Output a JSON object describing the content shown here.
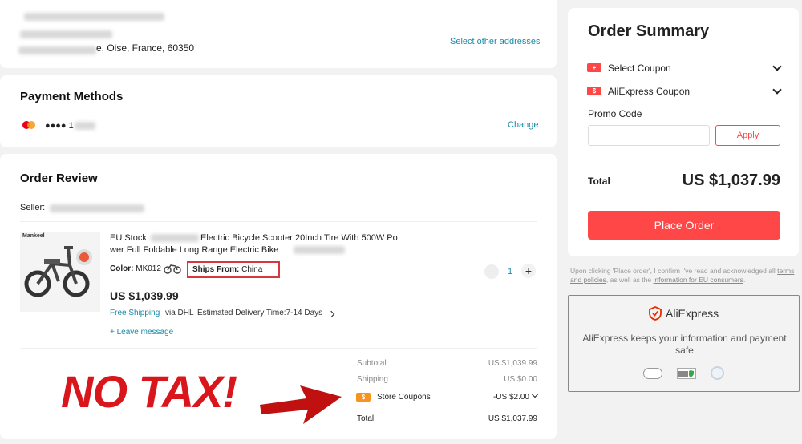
{
  "address": {
    "line3_suffix": "e, Oise, France, 60350",
    "select_other_label": "Select other addresses"
  },
  "payment": {
    "title": "Payment Methods",
    "card_dots": "●●●● 1",
    "change_label": "Change"
  },
  "review": {
    "title": "Order Review",
    "seller_label": "Seller:",
    "product_brand": "Mankeel",
    "product_title_part1": "EU Stock",
    "product_title_part2": "Electric Bicycle Scooter 20Inch Tire With 500W Po",
    "product_title_line2": "wer Full Foldable Long Range Electric Bike",
    "color_label": "Color:",
    "color_value": "MK012",
    "ships_from_label": "Ships From:",
    "ships_from_value": "China",
    "quantity": "1",
    "price": "US $1,039.99",
    "free_shipping": "Free Shipping",
    "shipping_via": "via DHL",
    "delivery_label": "Estimated Delivery Time:7-14 Days",
    "leave_message": "+ Leave message",
    "subtotal_label": "Subtotal",
    "subtotal_value": "US $1,039.99",
    "shipping_label": "Shipping",
    "shipping_value": "US $0.00",
    "store_coupons_label": "Store Coupons",
    "store_coupons_value": "-US $2.00",
    "total_label": "Total",
    "total_value": "US $1,037.99"
  },
  "overlay": {
    "text": "NO TAX!"
  },
  "summary": {
    "title": "Order Summary",
    "select_coupon_label": "Select Coupon",
    "ae_coupon_label": "AliExpress Coupon",
    "promo_code_label": "Promo Code",
    "apply_label": "Apply",
    "total_label": "Total",
    "total_value": "US $1,037.99",
    "place_order_label": "Place Order",
    "terms_text1": "Upon clicking 'Place order', I confirm I've read and acknowledged all",
    "terms_link1": "terms and policies",
    "terms_text2": ", as well as the",
    "terms_link2": "information for EU consumers",
    "terms_text3": "."
  },
  "trust": {
    "brand": "AliExpress",
    "message": "AliExpress keeps your information and payment safe"
  },
  "colors": {
    "accent_red": "#ff4747",
    "link_blue": "#1a8aa8",
    "overlay_red": "#d8161c"
  }
}
